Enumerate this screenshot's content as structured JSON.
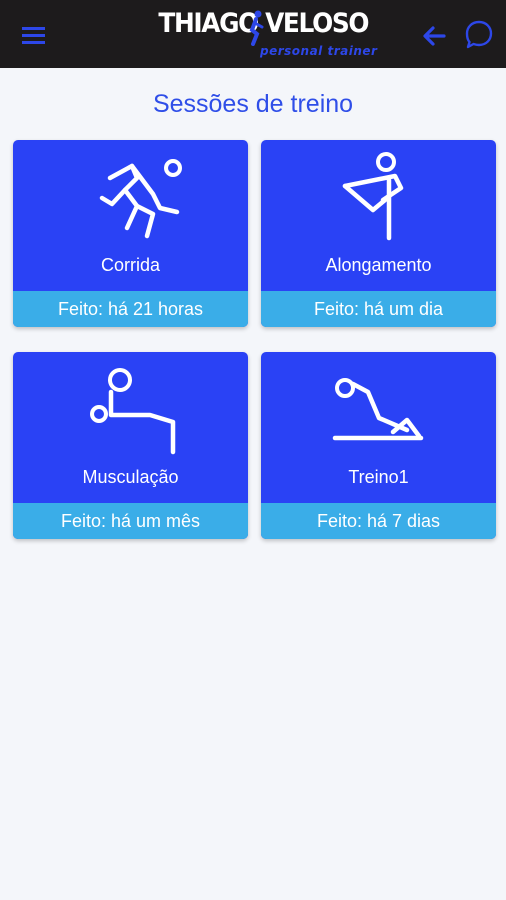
{
  "header": {
    "brand_name": "THIAGO VELOSO",
    "brand_subtitle": "personal trainer",
    "colors": {
      "bar_background": "#1d1b1c",
      "accent": "#2d47e8"
    }
  },
  "main": {
    "title": "Sessões de treino",
    "sessions": [
      {
        "icon": "running-person-icon",
        "label": "Corrida",
        "status": "Feito: há 21 horas"
      },
      {
        "icon": "stretching-person-icon",
        "label": "Alongamento",
        "status": "Feito: há um dia"
      },
      {
        "icon": "weightlifting-person-icon",
        "label": "Musculação",
        "status": "Feito: há um mês"
      },
      {
        "icon": "training-exercise-icon",
        "label": "Treino1",
        "status": "Feito: há 7 dias"
      }
    ],
    "colors": {
      "card": "#2a42f5",
      "card_footer": "#3aade8",
      "title": "#2f4ee8",
      "page_background": "#f4f6fa"
    }
  }
}
